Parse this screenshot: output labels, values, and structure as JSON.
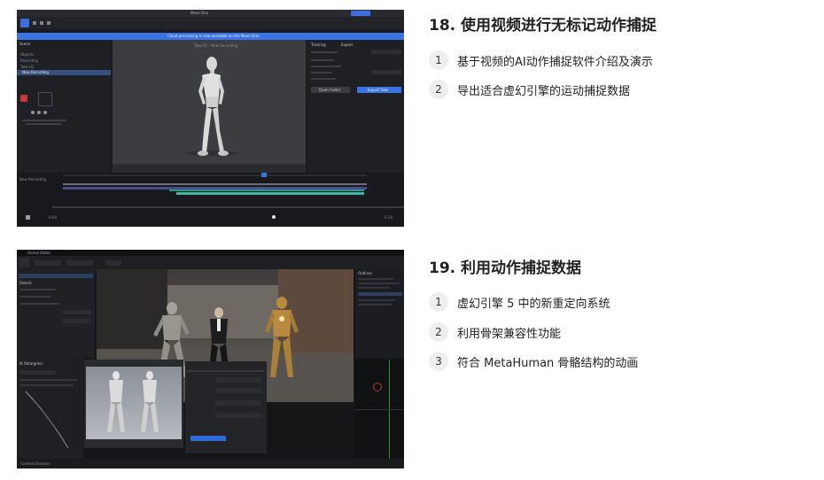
{
  "section1": {
    "title": "18. 使用视频进行无标记动作捕捉",
    "items": [
      {
        "num": "1",
        "text": "基于视频的AI动作捕捉软件介绍及演示"
      },
      {
        "num": "2",
        "text": "导出适合虚幻引擎的运动捕捉数据"
      }
    ]
  },
  "section2": {
    "title": "19. 利用动作捕捉数据",
    "items": [
      {
        "num": "1",
        "text": "虚幻引擎 5 中的新重定向系统"
      },
      {
        "num": "2",
        "text": "利用骨架兼容性功能"
      },
      {
        "num": "3",
        "text": "符合 MetaHuman 骨骼结构的动画"
      }
    ]
  },
  "app1": {
    "window_title": "Move One",
    "banner": "Cloud processing is now available on the Move One",
    "panel_title": "Scene",
    "items": [
      "Objects",
      "Recording",
      "Take 01"
    ],
    "selected_item": "New Recording",
    "viewport_label": "Take 01 - New Recording",
    "right_tab_a": "Tracking",
    "right_tab_b": "Export",
    "open_folder": "Open Folder",
    "export_button": "Export Take",
    "track_name": "New Recording",
    "time_start": "0:00",
    "time_end": "0:10"
  },
  "app2": {
    "window_title": "Unreal Editor",
    "panel_a": "IK Retargeter",
    "panel_b": "Details",
    "outliner": "Outliner",
    "content_browser": "Content Browser"
  }
}
